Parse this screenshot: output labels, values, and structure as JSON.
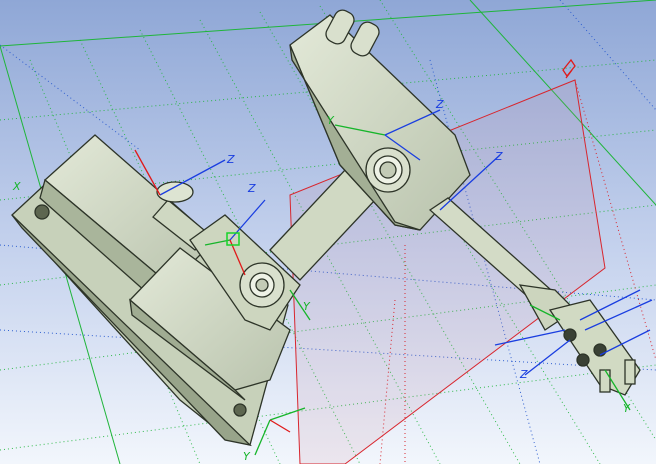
{
  "viewport": {
    "background_top": "#8fa7d6",
    "background_bottom": "#f2f6fc",
    "part_fill": "#d4ddc7",
    "part_shade": "#a9b59b",
    "part_outline": "#2d3428",
    "grid_green": "#1fb53a",
    "grid_blue": "#2f5fd0",
    "grid_red": "#d8262e",
    "axis_green": "#16b52a",
    "axis_blue": "#1a3ee0",
    "axis_red": "#e01a1a"
  },
  "axis_labels": {
    "y": "Y",
    "z": "Z",
    "x": "X"
  },
  "icons": [
    "coordinate-frame-icon",
    "selection-box-icon"
  ]
}
